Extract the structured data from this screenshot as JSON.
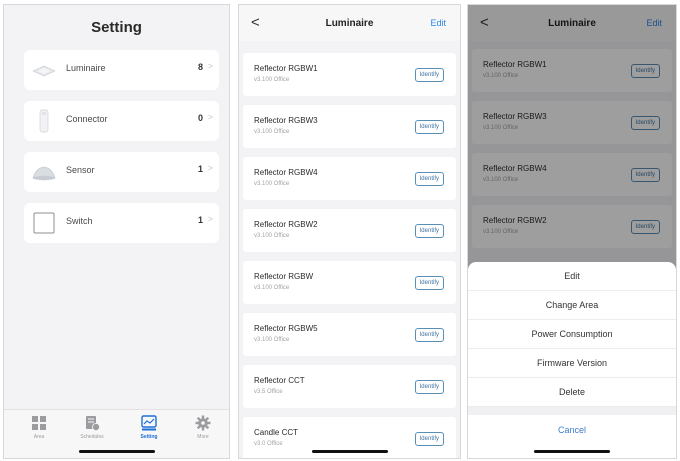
{
  "setting": {
    "title": "Setting",
    "devices": [
      {
        "name": "Luminaire",
        "count": "8",
        "icon": "luminaire-panel-icon"
      },
      {
        "name": "Connector",
        "count": "0",
        "icon": "connector-icon"
      },
      {
        "name": "Sensor",
        "count": "1",
        "icon": "sensor-icon"
      },
      {
        "name": "Switch",
        "count": "1",
        "icon": "switch-icon"
      }
    ],
    "tabs": [
      {
        "label": "Area",
        "icon": "area-grid-icon"
      },
      {
        "label": "Schedules",
        "icon": "schedules-icon"
      },
      {
        "label": "Setting",
        "icon": "setting-chart-icon",
        "active": true
      },
      {
        "label": "More",
        "icon": "gear-icon"
      }
    ],
    "accent": "#1c6ed8"
  },
  "luminaire": {
    "back_glyph": "<",
    "title": "Luminaire",
    "edit_label": "Edit",
    "identify_label": "Identify",
    "items": [
      {
        "name": "Reflector RGBW1",
        "sub": "v3.100 Office"
      },
      {
        "name": "Reflector RGBW3",
        "sub": "v3.100 Office"
      },
      {
        "name": "Reflector RGBW4",
        "sub": "v3.100 Office"
      },
      {
        "name": "Reflector RGBW2",
        "sub": "v3.100 Office"
      },
      {
        "name": "Reflector RGBW",
        "sub": "v3.100 Office"
      },
      {
        "name": "Reflector RGBW5",
        "sub": "v3.100 Office"
      },
      {
        "name": "Reflector CCT",
        "sub": "v3.5 Office"
      },
      {
        "name": "Candle CCT",
        "sub": "v3.0 Office"
      }
    ]
  },
  "action_sheet": {
    "items": [
      "Edit",
      "Change Area",
      "Power Consumption",
      "Firmware Version",
      "Delete"
    ],
    "cancel_label": "Cancel"
  }
}
